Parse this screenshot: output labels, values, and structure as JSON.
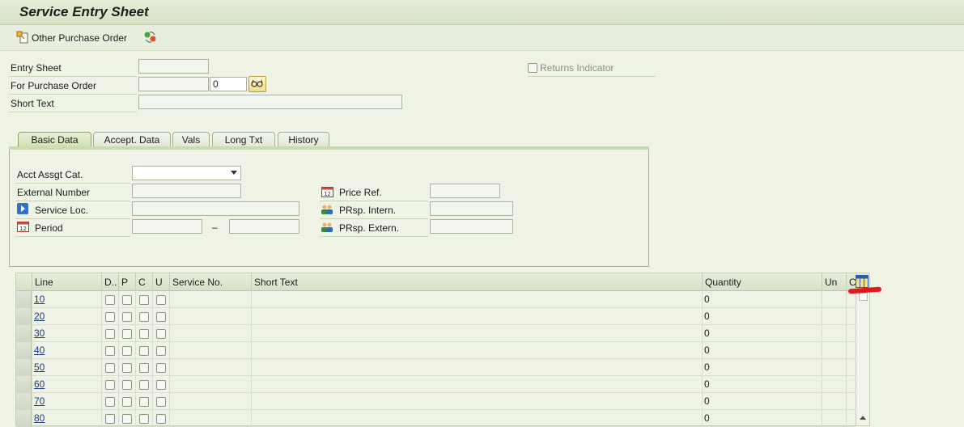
{
  "window": {
    "title": "Service Entry Sheet"
  },
  "toolbar": {
    "other_po_label": "Other Purchase Order"
  },
  "header": {
    "entry_sheet_label": "Entry Sheet",
    "entry_sheet_value": "",
    "returns_indicator_label": "Returns Indicator",
    "po_label": "For Purchase Order",
    "po_value": "",
    "po_item_value": "0",
    "short_text_label": "Short Text",
    "short_text_value": ""
  },
  "tabs": [
    {
      "label": "Basic Data",
      "active": true
    },
    {
      "label": "Accept. Data"
    },
    {
      "label": "Vals"
    },
    {
      "label": "Long Txt"
    },
    {
      "label": "History"
    }
  ],
  "basic": {
    "acct_assgt_label": "Acct Assgt Cat.",
    "external_number_label": "External Number",
    "service_loc_label": "Service Loc.",
    "period_label": "Period",
    "period_dash": "–",
    "price_ref_label": "Price Ref.",
    "prsp_intern_label": "PRsp. Intern.",
    "prsp_extern_label": "PRsp. Extern."
  },
  "table": {
    "columns": [
      "Line",
      "D..",
      "P",
      "C",
      "U",
      "Service No.",
      "Short Text",
      "Quantity",
      "Un",
      "C"
    ],
    "rows": [
      {
        "line": "10",
        "quantity": "0"
      },
      {
        "line": "20",
        "quantity": "0"
      },
      {
        "line": "30",
        "quantity": "0"
      },
      {
        "line": "40",
        "quantity": "0"
      },
      {
        "line": "50",
        "quantity": "0"
      },
      {
        "line": "60",
        "quantity": "0"
      },
      {
        "line": "70",
        "quantity": "0"
      },
      {
        "line": "80",
        "quantity": "0"
      }
    ]
  },
  "colors": {
    "background": "#eef3e6",
    "annotation_red": "#e3171f"
  }
}
